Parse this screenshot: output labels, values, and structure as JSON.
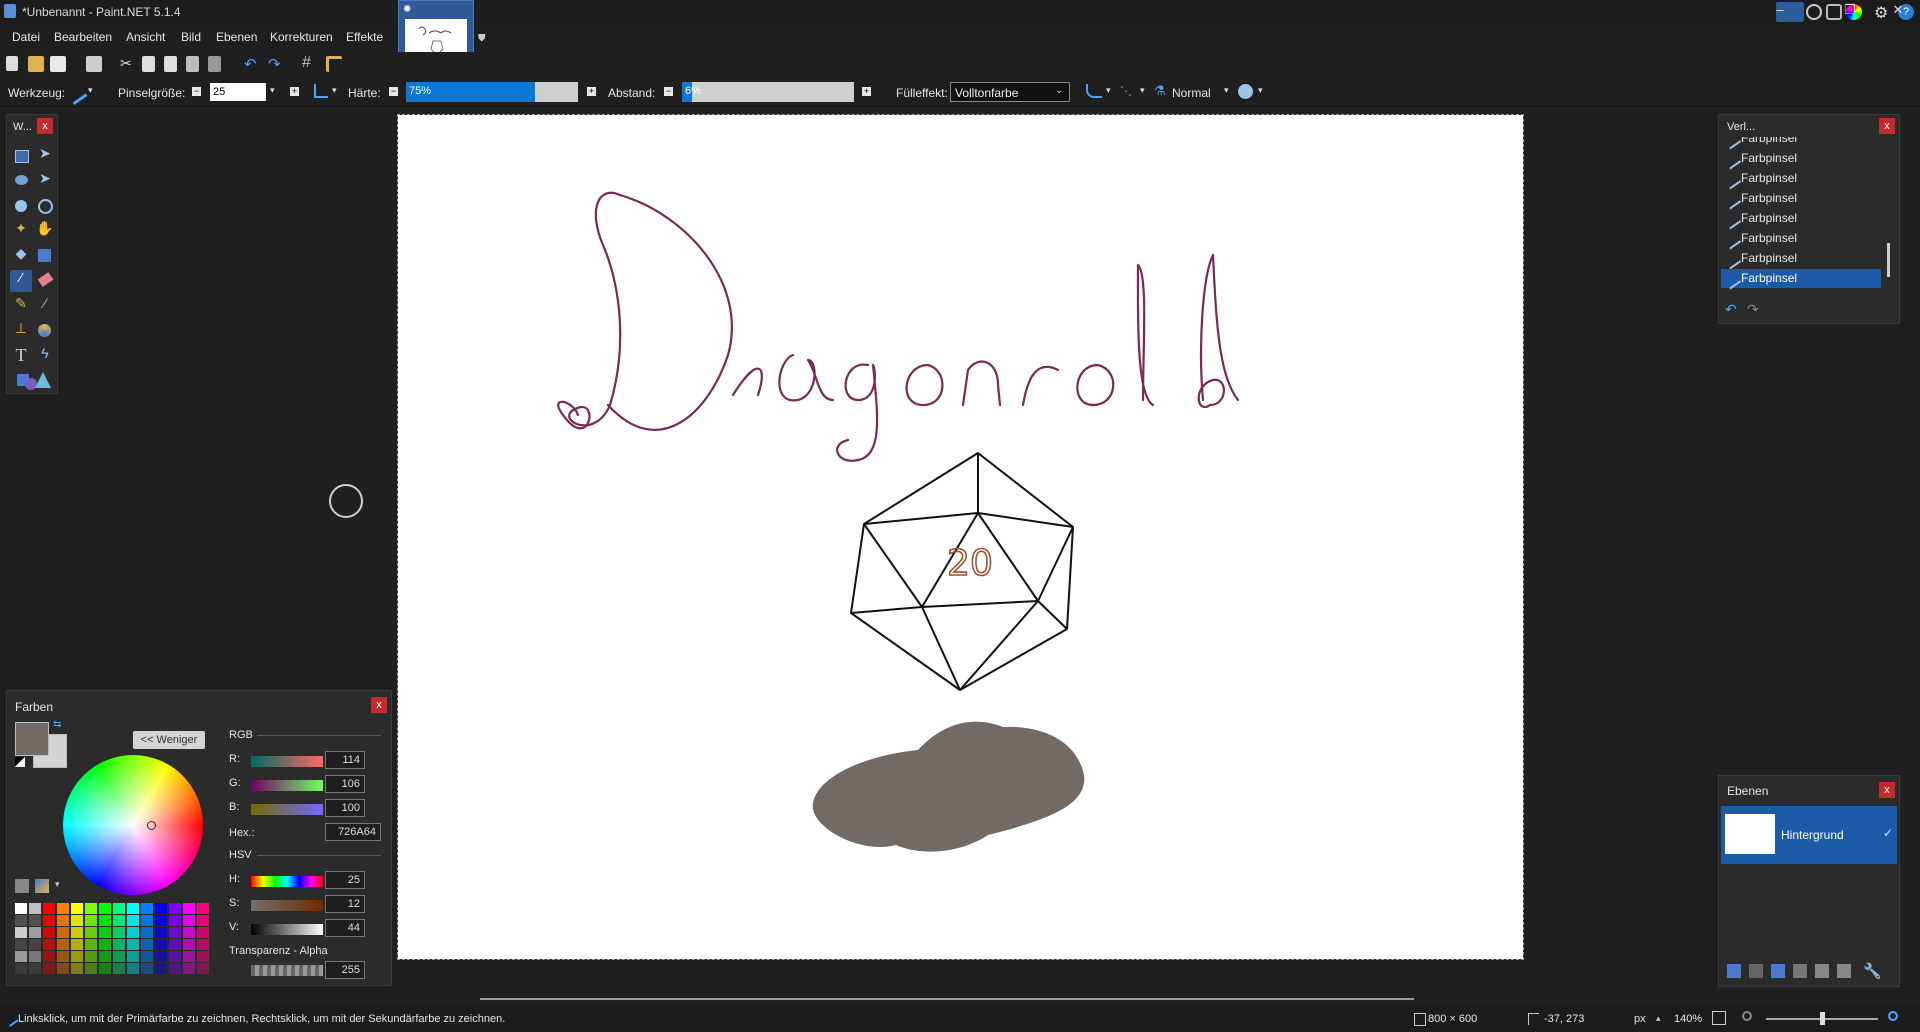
{
  "window": {
    "title": "*Unbenannt - Paint.NET 5.1.4",
    "controls": [
      "–",
      "❐",
      "✕"
    ]
  },
  "menu": [
    "Datei",
    "Bearbeiten",
    "Ansicht",
    "Bild",
    "Ebenen",
    "Korrekturen",
    "Effekte"
  ],
  "toolbar": {
    "werkzeug_label": "Werkzeug:",
    "pinsel_label": "Pinselgröße:",
    "pinsel_value": "25",
    "haerte_label": "Härte:",
    "haerte_value": "75%",
    "haerte_fraction": 0.75,
    "abstand_label": "Abstand:",
    "abstand_value": "6%",
    "abstand_fraction": 0.06,
    "fuell_label": "Fülleffekt:",
    "fuell_value": "Volltonfarbe",
    "blend_value": "Normal"
  },
  "tools_panel": {
    "title": "W..."
  },
  "history": {
    "title": "Verl...",
    "items": [
      "Farbpinsel",
      "Farbpinsel",
      "Farbpinsel",
      "Farbpinsel",
      "Farbpinsel",
      "Farbpinsel",
      "Farbpinsel",
      "Farbpinsel"
    ],
    "selected_index": 7
  },
  "layers": {
    "title": "Ebenen",
    "items": [
      "Hintergrund"
    ]
  },
  "colors": {
    "title": "Farben",
    "less_button": "<< Weniger",
    "rgb_label": "RGB",
    "r_label": "R:",
    "g_label": "G:",
    "b_label": "B:",
    "r": "114",
    "g": "106",
    "b": "100",
    "hex_label": "Hex.:",
    "hex": "726A64",
    "hsv_label": "HSV",
    "h_label": "H:",
    "s_label": "S:",
    "v_label": "V:",
    "h": "25",
    "s": "12",
    "v": "44",
    "alpha_label": "Transparenz - Alpha",
    "alpha": "255",
    "primary": "#726a64",
    "secondary": "#d4d4d4"
  },
  "canvas": {
    "title_text": "Dragonroll",
    "die_number": "20",
    "ink_color": "#7a2a55",
    "number_color": "#a0522d",
    "shadow_color": "#726a64"
  },
  "status": {
    "hint": "Linksklick, um mit der Primärfarbe zu zeichnen, Rechtsklick, um mit der Sekundärfarbe zu zeichnen.",
    "image_size": "800 × 600",
    "cursor_pos": "-37, 273",
    "unit": "px",
    "zoom": "140%"
  },
  "accent": "#0c78d4"
}
